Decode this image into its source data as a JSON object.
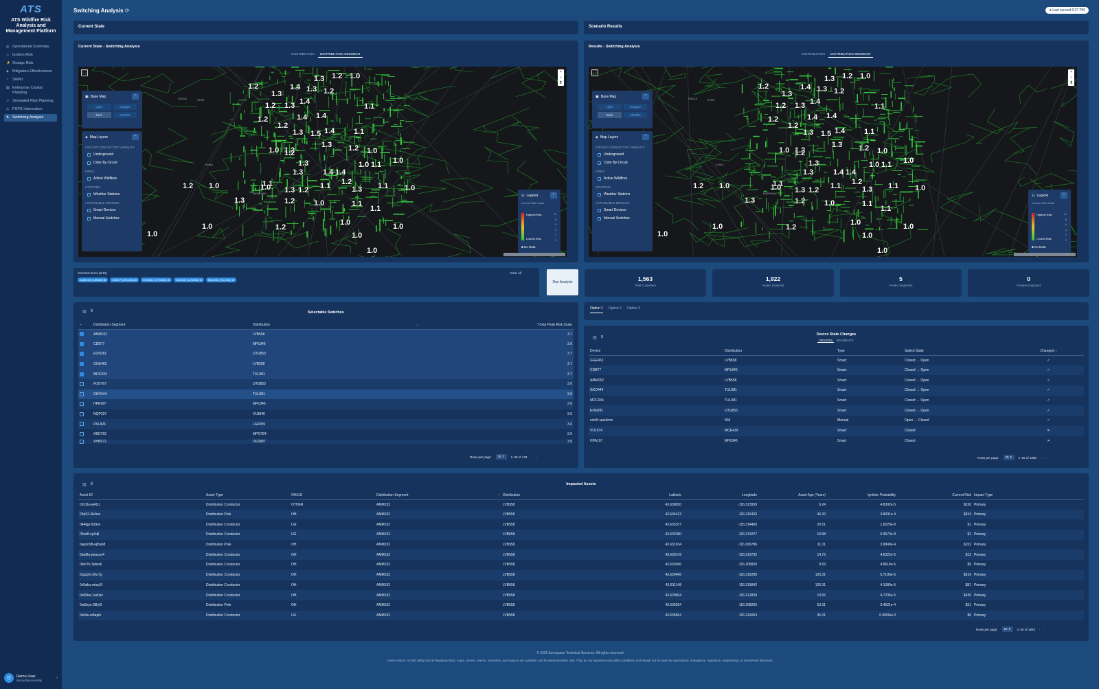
{
  "sidebar": {
    "logo": "ATS",
    "brand": "ATS Wildfire Risk Analysis and Management Platform",
    "items": [
      {
        "label": "Operational Summary",
        "icon": "summary-icon",
        "glyph": "◎"
      },
      {
        "label": "Ignition Risk",
        "icon": "flame-icon",
        "glyph": "♨"
      },
      {
        "label": "Outage Risk",
        "icon": "bolt-icon",
        "glyph": "⚡"
      },
      {
        "label": "Mitigation Effectiveness",
        "icon": "shield-icon",
        "glyph": "◈"
      },
      {
        "label": "SWMI",
        "icon": "gauge-icon",
        "glyph": "◔"
      },
      {
        "label": "Enterprise Capital Planning",
        "icon": "chart-icon",
        "glyph": "▤"
      },
      {
        "label": "Simulated Risk Planning",
        "icon": "trend-icon",
        "glyph": "↗"
      },
      {
        "label": "PSPS Information",
        "icon": "alert-icon",
        "glyph": "⚠"
      },
      {
        "label": "Switching Analysis",
        "icon": "switch-icon",
        "glyph": "⇅"
      }
    ],
    "user": {
      "initial": "D",
      "name": "Demo User",
      "email": "demo@acmeutility"
    }
  },
  "header": {
    "title": "Switching Analysis",
    "sync": "Last synced 6:27 PM"
  },
  "current": {
    "title": "Current State",
    "map_title": "Current State - Switching Analysis"
  },
  "scenario": {
    "title": "Scenario Results",
    "map_title": "Results - Switching Analysis"
  },
  "map": {
    "toggle": [
      "DISTRIBUTION",
      "DISTRIBUTION SEGMENT"
    ],
    "basemap": {
      "title": "Base Map",
      "options": [
        "Light",
        "Voyager",
        "Dark",
        "Satellite"
      ]
    },
    "layers": {
      "title": "Map Layers",
      "sections": [
        {
          "title": "CIRCUIT CONDUCTOR VISIBILITY",
          "items": [
            "Underground",
            "Color By Circuit"
          ]
        },
        {
          "title": "FIRES",
          "items": [
            "Active Wildfires"
          ]
        },
        {
          "title": "STATIONS",
          "items": [
            "Weather Stations"
          ]
        },
        {
          "title": "ACTIONABLE DEVICES",
          "items": [
            "Smart Devices",
            "Manual Switches"
          ]
        }
      ]
    },
    "legend": {
      "title": "Legend",
      "subtitle": "Current Risk Scale",
      "high": "Highest Risk",
      "low": "Lowest Risk",
      "nodata": "No Data",
      "ticks": [
        "11",
        "8",
        "6",
        "4",
        "2",
        "1"
      ]
    },
    "places": [
      "MERIDIAN",
      "EAGLE",
      "STAR",
      "KUNA"
    ],
    "labels": [
      "1.3",
      "1.2",
      "1.0",
      "1.2",
      "1.3",
      "1.4",
      "1.3",
      "1.2",
      "1.2",
      "1.3",
      "1.4",
      "1.1",
      "1.2",
      "1.4",
      "1.4",
      "1.2",
      "1.3",
      "1.5",
      "1.4",
      "1.1",
      "1.0",
      "1.2",
      "1.3",
      "1.2",
      "1.0",
      "1.0",
      "1.1",
      "1.0",
      "1.2",
      "1.3",
      "1.4",
      "1.3",
      "1.4",
      "1.2",
      "1.1",
      "1.1",
      "1.3",
      "1.2",
      "1.3",
      "1.1",
      "1.0",
      "1.0",
      "1.2",
      "1.3",
      "1.2",
      "1.0",
      "1.0",
      "1.1",
      "1.1",
      "1.0",
      "1.0",
      "1.2",
      "1.0",
      "1.0",
      "1.0",
      "1.0"
    ]
  },
  "selection": {
    "label": "Selected Items (5/10)",
    "clear": "Clear All",
    "chips": [
      "AMM152 (LVB558)",
      "CDB77 (MPL846)",
      "EON281 (UTG853)",
      "GGE462 (LVB558)",
      "MDC334 (TUL981)"
    ],
    "run": "Run Analysis"
  },
  "stats": [
    {
      "value": "1,563",
      "label": "Total Customers"
    },
    {
      "value": "1,922",
      "label": "Assets Impacted"
    },
    {
      "value": "5",
      "label": "Feeder Segments"
    },
    {
      "value": "0",
      "label": "Feeders Impacted"
    }
  ],
  "switches": {
    "title": "Selectable Switches",
    "columns": [
      "Distribution Segment",
      "Distribution",
      "7-Day Peak Risk Scale"
    ],
    "sort_glyph": "↓",
    "rows": [
      {
        "seg": "AMM152",
        "dist": "LVB558",
        "risk": "3.7",
        "checked": true
      },
      {
        "seg": "CDB77",
        "dist": "MPL846",
        "risk": "3.6",
        "checked": true
      },
      {
        "seg": "EON281",
        "dist": "UTG853",
        "risk": "3.7",
        "checked": true
      },
      {
        "seg": "GGE462",
        "dist": "LVB558",
        "risk": "3.7",
        "checked": true
      },
      {
        "seg": "MDC334",
        "dist": "TUL981",
        "risk": "3.7",
        "checked": true
      },
      {
        "seg": "FDO767",
        "dist": "UTG853",
        "risk": "3.6",
        "checked": false
      },
      {
        "seg": "GKO444",
        "dist": "TUL981",
        "risk": "3.6",
        "checked": false
      },
      {
        "seg": "HPA197",
        "dist": "MPL846",
        "risk": "3.6",
        "checked": false
      },
      {
        "seg": "NQP337",
        "dist": "VLB846",
        "risk": "3.6",
        "checked": false
      },
      {
        "seg": "PKL826",
        "dist": "LAR059",
        "risk": "3.6",
        "checked": false
      },
      {
        "seg": "XBO762",
        "dist": "MPO784",
        "risk": "3.6",
        "checked": false
      },
      {
        "seg": "XHR072",
        "dist": "DES887",
        "risk": "3.6",
        "checked": false
      }
    ],
    "rows_per_page": "Rows per page:",
    "page_size": "25",
    "range": "1–25 of 143"
  },
  "options": [
    "Option 1",
    "Option 2",
    "Option 3"
  ],
  "devices": {
    "title": "Device State Changes",
    "tabs": [
      "DEVICES",
      "SEGMENTS"
    ],
    "columns": [
      "Device",
      "Distribution",
      "Type",
      "Switch State",
      "Changed"
    ],
    "sort_glyph": "↓",
    "rows": [
      {
        "device": "GGE462",
        "dist": "LVB558",
        "type": "Smart",
        "state": "Closed → Open",
        "changed": "✓"
      },
      {
        "device": "CDB77",
        "dist": "MPL846",
        "type": "Smart",
        "state": "Closed → Open",
        "changed": "✓"
      },
      {
        "device": "AMM152",
        "dist": "LVB558",
        "type": "Smart",
        "state": "Closed → Open",
        "changed": "✓"
      },
      {
        "device": "GKO444",
        "dist": "TUL981",
        "type": "Smart",
        "state": "Closed → Open",
        "changed": "✓"
      },
      {
        "device": "MDC334",
        "dist": "TUL981",
        "type": "Smart",
        "state": "Closed → Open",
        "changed": "✓"
      },
      {
        "device": "EON281",
        "dist": "UTG853",
        "type": "Smart",
        "state": "Closed → Open",
        "changed": "✓"
      },
      {
        "device": "ncb4r-apa3mm",
        "dist": "N/A",
        "type": "Manual",
        "state": "Open → Closed",
        "changed": "✓"
      },
      {
        "device": "VUL974",
        "dist": "MCE419",
        "type": "Smart",
        "state": "Closed",
        "changed": "✕"
      },
      {
        "device": "HPA197",
        "dist": "MPL846",
        "type": "Smart",
        "state": "Closed",
        "changed": "✕"
      }
    ],
    "rows_per_page": "Rows per page:",
    "page_size": "25",
    "range": "1–25 of 1088"
  },
  "assets": {
    "title": "Impacted Assets",
    "columns": [
      "Asset ID",
      "Asset Type",
      "OH/UG",
      "Distribution Segment",
      "Distribution",
      "Latitude",
      "Longitude",
      "Asset Age (Years)",
      "Ignition Probability",
      "Current Risk",
      "Impact Type"
    ],
    "sort_glyph": "↑",
    "rows": [
      [
        "01h3lu-ej41rj",
        "Distribution Conductor",
        "OTHER",
        "AMM152",
        "LVB558",
        "43.630050",
        "-116.313939",
        "6.24",
        "4.8092e-5",
        "$230",
        "Primary"
      ],
      [
        "03q92-6b4cw",
        "Distribution Pole",
        "OH",
        "AMM152",
        "LVB558",
        "43.634413",
        "-116.316433",
        "46.32",
        "3.8091e-4",
        "$834",
        "Primary"
      ],
      [
        "044lgp-509ye",
        "Distribution Conductor",
        "UG",
        "AMM152",
        "LVB558",
        "43.633107",
        "-116.314400",
        "20.51",
        "1.6229e-8",
        "$1",
        "Primary"
      ],
      [
        "05sd8-cy6qll",
        "Distribution Conductor",
        "UG",
        "AMM152",
        "LVB558",
        "43.632380",
        "-116.313227",
        "13.98",
        "6.9573e-8",
        "$1",
        "Primary"
      ],
      [
        "0apnn98-ejl5ab8",
        "Distribution Pole",
        "OH",
        "AMM152",
        "LVB558",
        "43.631934",
        "-116.306786",
        "11.01",
        "3.9840e-4",
        "$152",
        "Primary"
      ],
      [
        "0ba8la-peacue4",
        "Distribution Conductor",
        "OH",
        "AMM152",
        "LVB558",
        "43.630142",
        "-116.319732",
        "14.73",
        "4.6322e-5",
        "$13",
        "Primary"
      ],
      [
        "0bm7h-3ebedi",
        "Distribution Conductor",
        "OH",
        "AMM152",
        "LVB558",
        "43.633496",
        "-116.305830",
        "9.59",
        "4.8618e-5",
        "$9",
        "Primary"
      ],
      [
        "0cpq2n-2ihc7g",
        "Distribution Conductor",
        "OH",
        "AMM152",
        "LVB558",
        "43.629466",
        "-116.316289",
        "126.31",
        "5.7105e-5",
        "$510",
        "Primary"
      ],
      [
        "0r0aiku-mtxp2f",
        "Distribution Conductor",
        "OH",
        "AMM152",
        "LVB558",
        "43.631148",
        "-116.315842",
        "126.31",
        "4.1089e-5",
        "$81",
        "Primary"
      ],
      [
        "0s65ka-1uz0az",
        "Distribution Conductor",
        "OH",
        "AMM152",
        "LVB558",
        "43.629004",
        "-116.312830",
        "10.65",
        "4.7235e-5",
        "$430",
        "Primary"
      ],
      [
        "0w5bya-i38y6l",
        "Distribution Pole",
        "OH",
        "AMM152",
        "LVB558",
        "43.630394",
        "-116.308266",
        "53.31",
        "3.4521e-4",
        "$31",
        "Primary"
      ],
      [
        "0x6du-w8apih",
        "Distribution Conductor",
        "UG",
        "AMM152",
        "LVB558",
        "43.635864",
        "-116.316053",
        "35.31",
        "0.0000e+0",
        "$0",
        "Primary"
      ]
    ],
    "rows_per_page": "Rows per page:",
    "page_size": "25",
    "range": "1–25 of 1904"
  },
  "footer": {
    "copyright": "© 2025 Aerospace Technical Services. All rights reserved.",
    "notice": "Demo Notice: ACME Utility and all displayed data, maps, assets, events, scenarios, and outputs are synthetic and for demonstration only. They do not represent real utility conditions and should not be used for operational, emergency, regulatory, engineering, or investment decisions."
  },
  "colors": {
    "bg": "#1d4a7c",
    "panel": "#16335e",
    "sidebar": "#122b52",
    "accent": "#2f8ee3",
    "network": "#2fb83e"
  }
}
